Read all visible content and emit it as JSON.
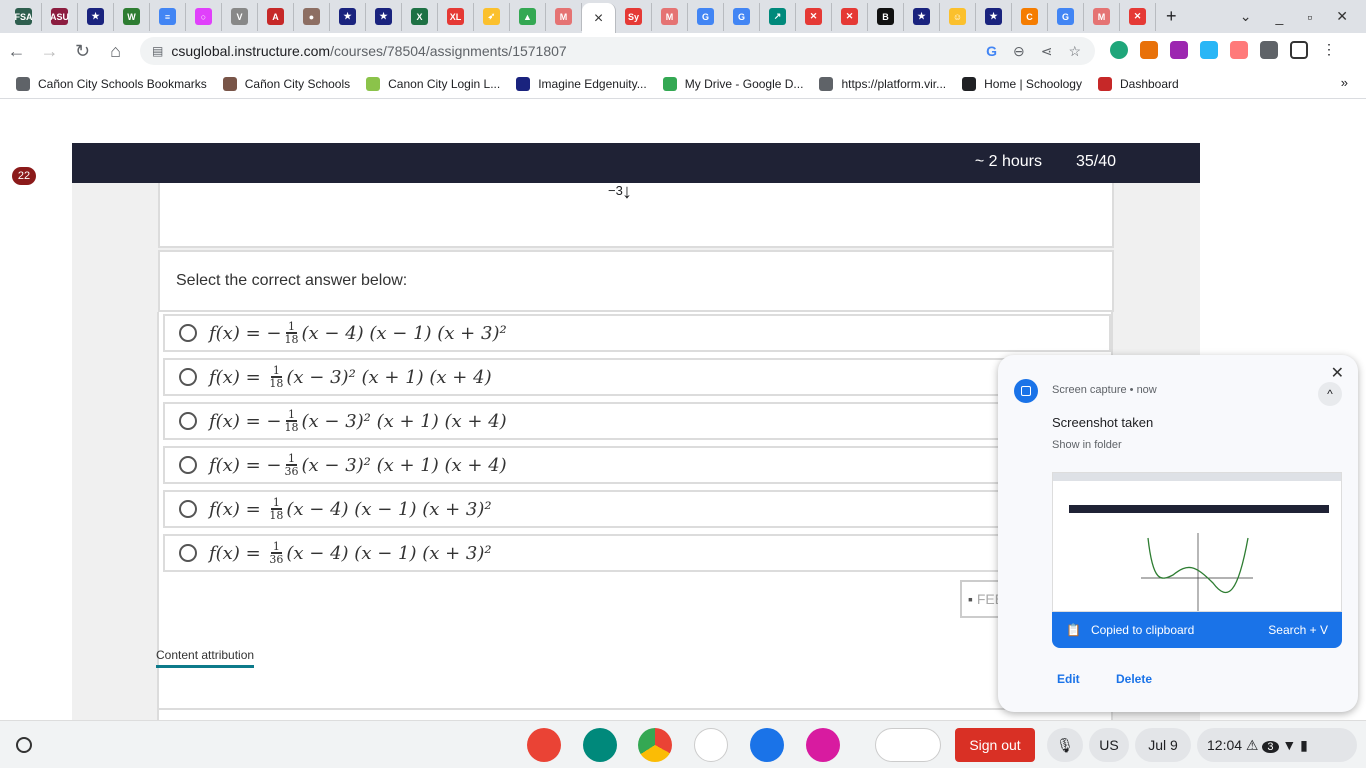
{
  "browser": {
    "tabs": [
      {
        "label": "FSA",
        "color": "#2e5e4e"
      },
      {
        "label": "ASU",
        "color": "#8c1d40"
      },
      {
        "label": "★",
        "color": "#1a237e"
      },
      {
        "label": "W",
        "color": "#2e7d32"
      },
      {
        "label": "≡",
        "color": "#4285f4"
      },
      {
        "label": "○",
        "color": "#e040fb"
      },
      {
        "label": "V",
        "color": "#888"
      },
      {
        "label": "A",
        "color": "#c62828"
      },
      {
        "label": "●",
        "color": "#8d6e63"
      },
      {
        "label": "★",
        "color": "#1a237e"
      },
      {
        "label": "★",
        "color": "#1a237e"
      },
      {
        "label": "X",
        "color": "#1e7145"
      },
      {
        "label": "XL",
        "color": "#e53935"
      },
      {
        "label": "➶",
        "color": "#fbc02d"
      },
      {
        "label": "▲",
        "color": "#34a853"
      },
      {
        "label": "M",
        "color": "#e57373"
      },
      {
        "label": "×",
        "color": "#333",
        "active": true
      },
      {
        "label": "Sy",
        "color": "#e53935"
      },
      {
        "label": "M",
        "color": "#e57373"
      },
      {
        "label": "G",
        "color": "#4285f4"
      },
      {
        "label": "G",
        "color": "#4285f4"
      },
      {
        "label": "↗",
        "color": "#00897b"
      },
      {
        "label": "✕",
        "color": "#e53935"
      },
      {
        "label": "✕",
        "color": "#e53935"
      },
      {
        "label": "B",
        "color": "#111"
      },
      {
        "label": "★",
        "color": "#1a237e"
      },
      {
        "label": "☺",
        "color": "#fbc02d"
      },
      {
        "label": "★",
        "color": "#1a237e"
      },
      {
        "label": "C",
        "color": "#f57c00"
      },
      {
        "label": "G",
        "color": "#4285f4"
      },
      {
        "label": "M",
        "color": "#e57373"
      },
      {
        "label": "✕",
        "color": "#e53935"
      }
    ],
    "new_tab": "+",
    "url_host": "csuglobal.instructure.com",
    "url_path": "/courses/78504/assignments/1571807",
    "bookmarks": [
      {
        "label": "Cañon City Schools Bookmarks",
        "color": "#5f6368"
      },
      {
        "label": "Cañon City Schools",
        "color": "#795548"
      },
      {
        "label": "Canon City Login L...",
        "color": "#8bc34a"
      },
      {
        "label": "Imagine Edgenuity...",
        "color": "#1a237e"
      },
      {
        "label": "My Drive - Google D...",
        "color": "#34a853"
      },
      {
        "label": "https://platform.vir...",
        "color": "#5f6368"
      },
      {
        "label": "Home | Schoology",
        "color": "#202124"
      },
      {
        "label": "Dashboard",
        "color": "#c62828"
      }
    ],
    "bookmarks_more": "»"
  },
  "quiz": {
    "question_badge": "22",
    "time_left": "~ 2 hours",
    "progress": "35/40",
    "graph_tick": "−3",
    "prompt": "Select the correct answer below:",
    "options": [
      {
        "lhs": "f(x) = ",
        "sign": "−",
        "num": "1",
        "den": "18",
        "body": "(x − 4) (x − 1) (x + 3)²"
      },
      {
        "lhs": "f(x) = ",
        "sign": "",
        "num": "1",
        "den": "18",
        "body": "(x − 3)² (x + 1) (x + 4)"
      },
      {
        "lhs": "f(x) = ",
        "sign": "−",
        "num": "1",
        "den": "18",
        "body": "(x − 3)² (x + 1) (x + 4)"
      },
      {
        "lhs": "f(x) = ",
        "sign": "−",
        "num": "1",
        "den": "36",
        "body": "(x − 3)² (x + 1) (x + 4)"
      },
      {
        "lhs": "f(x) = ",
        "sign": "",
        "num": "1",
        "den": "18",
        "body": "(x − 4) (x − 1) (x + 3)²"
      },
      {
        "lhs": "f(x) = ",
        "sign": "",
        "num": "1",
        "den": "36",
        "body": "(x − 4) (x − 1) (x + 3)²"
      }
    ],
    "feedback_label": "FEEDBACK",
    "content_attribution": "Content attribution"
  },
  "notification": {
    "source": "Screen capture • now",
    "title": "Screenshot taken",
    "subtitle": "Show in folder",
    "copied": "Copied to clipboard",
    "shortcut": "Search + V",
    "edit": "Edit",
    "delete": "Delete"
  },
  "shelf": {
    "sign_out": "Sign out",
    "ime": "US",
    "date": "Jul 9",
    "time": "12:04",
    "notif_count": "3"
  }
}
